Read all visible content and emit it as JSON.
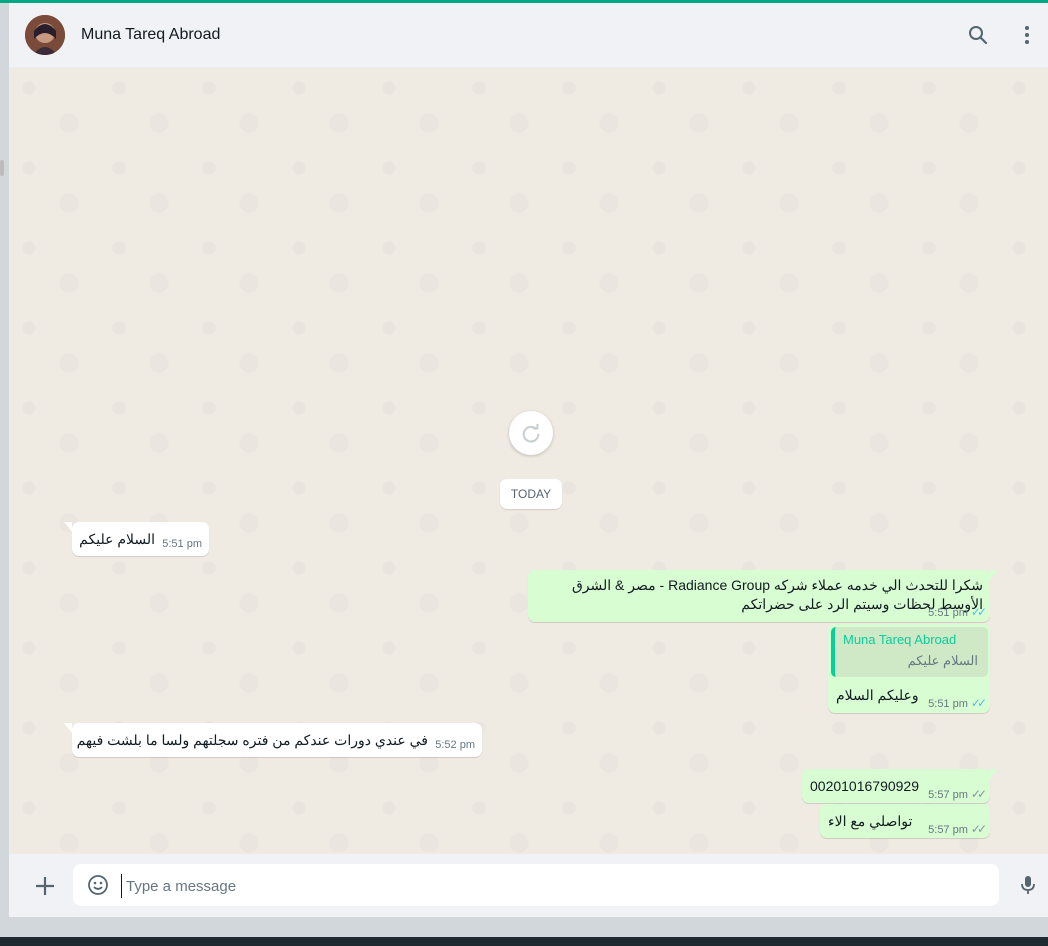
{
  "header": {
    "contact_name": "Muna Tareq Abroad",
    "search_icon": "search-icon",
    "menu_icon": "more-vertical-icon"
  },
  "chat": {
    "date_label": "TODAY",
    "messages": [
      {
        "direction": "in",
        "text": "السلام عليكم",
        "time": "5:51 pm"
      },
      {
        "direction": "out",
        "text": "شكرا للتحدث الي خدمه عملاء شركه Radiance Group - مصر & الشرق الأوسط لحظات وسيتم الرد على حضراتكم",
        "time": "5:51 pm",
        "status": "read"
      },
      {
        "direction": "out",
        "reply_to": {
          "name": "Muna Tareq Abroad",
          "text": "السلام عليكم"
        },
        "text": "وعليكم السلام",
        "time": "5:51 pm",
        "status": "read"
      },
      {
        "direction": "in",
        "text": "في عندي دورات عندكم من فتره سجلتهم ولسا ما بلشت فيهم",
        "time": "5:52 pm"
      },
      {
        "direction": "out",
        "text": "00201016790929",
        "time": "5:57 pm",
        "status": "delivered"
      },
      {
        "direction": "out",
        "text": "تواصلي مع الاء",
        "time": "5:57 pm",
        "status": "delivered"
      }
    ]
  },
  "footer": {
    "placeholder": "Type a message",
    "attach_icon": "plus-icon",
    "emoji_icon": "emoji-icon",
    "mic_icon": "microphone-icon"
  },
  "colors": {
    "accent": "#00a884",
    "outgoing_bubble": "#d9fdd3",
    "incoming_bubble": "#ffffff",
    "read_ticks": "#53bdeb",
    "chat_background": "#efeae2"
  }
}
